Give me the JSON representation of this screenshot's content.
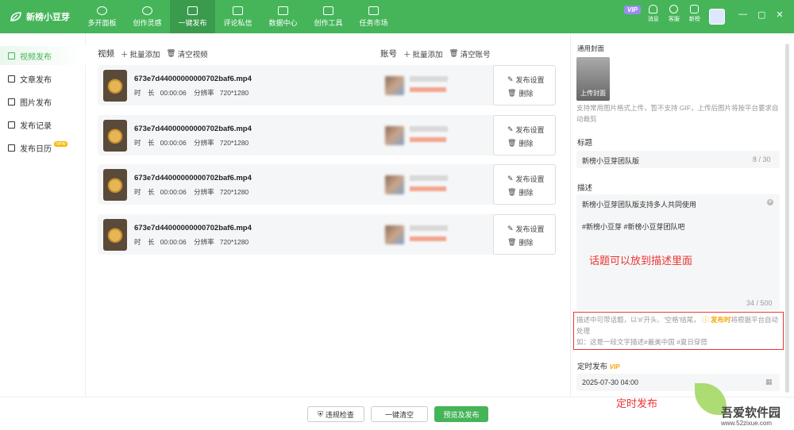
{
  "app": {
    "title": "新榜小豆芽"
  },
  "nav": [
    {
      "label": "多开面板"
    },
    {
      "label": "创作灵感"
    },
    {
      "label": "一键发布"
    },
    {
      "label": "评论私信"
    },
    {
      "label": "数据中心"
    },
    {
      "label": "创作工具"
    },
    {
      "label": "任务市场"
    }
  ],
  "tools": {
    "vip": "VIP",
    "messages": "消息",
    "service": "客服",
    "xinbang": "新榜"
  },
  "window": {
    "minimize": "—",
    "maximize": "▢",
    "close": "✕"
  },
  "sidebar": [
    {
      "label": "视频发布"
    },
    {
      "label": "文章发布"
    },
    {
      "label": "图片发布"
    },
    {
      "label": "发布记录"
    },
    {
      "label": "发布日历",
      "badge": "new"
    }
  ],
  "video_header": {
    "title": "视频",
    "batch_add": "批量添加",
    "clear": "清空视频"
  },
  "account_header": {
    "title": "账号",
    "batch_add": "批量添加",
    "clear": "清空账号"
  },
  "videos": [
    {
      "file": "673e7d44000000000702baf6.mp4",
      "dur_label": "时　长",
      "duration": "00:00:06",
      "res_label": "分辨率",
      "resolution": "720*1280",
      "settings": "发布设置",
      "delete": "删除"
    },
    {
      "file": "673e7d44000000000702baf6.mp4",
      "dur_label": "时　长",
      "duration": "00:00:06",
      "res_label": "分辨率",
      "resolution": "720*1280",
      "settings": "发布设置",
      "delete": "删除"
    },
    {
      "file": "673e7d44000000000702baf6.mp4",
      "dur_label": "时　长",
      "duration": "00:00:06",
      "res_label": "分辨率",
      "resolution": "720*1280",
      "settings": "发布设置",
      "delete": "删除"
    },
    {
      "file": "673e7d44000000000702baf6.mp4",
      "dur_label": "时　长",
      "duration": "00:00:06",
      "res_label": "分辨率",
      "resolution": "720*1280",
      "settings": "发布设置",
      "delete": "删除"
    }
  ],
  "panel": {
    "cover_label": "通用封面",
    "upload_cover": "上传封面",
    "cover_hint": "支持常用图片格式上传，暂不支持 GIF，上传后图片将按平台要求自动裁剪",
    "title_label": "标题",
    "title_value": "新榜小豆芽团队版",
    "title_count": "8 / 30",
    "desc_label": "描述",
    "desc_line1": "新榜小豆芽团队版支持多人共同使用",
    "desc_line2": "#新榜小豆芽 #新榜小豆芽团队吧",
    "desc_count": "34 / 500",
    "annotation_topics": "话题可以放到描述里面",
    "notice_a": "描述中可带话题，以'#'开头、'空格'结尾，",
    "notice_b": "发布时",
    "notice_c": "将根据平台自动处理",
    "notice_d": "如：这是一段文字描述#最美中国 #夏日穿搭",
    "schedule_label": "定时发布",
    "schedule_vip": "VIP",
    "schedule_value": "2025-07-30 04:00",
    "annotation_schedule": "定时发布"
  },
  "bottom": {
    "check": "违规检查",
    "clear": "一键清空",
    "publish": "预览及发布"
  },
  "watermark": {
    "title": "吾爱软件园",
    "url": "www.52zixue.com"
  },
  "colors": {
    "brand": "#46b55a",
    "annotation": "#e33333",
    "vip": "#9b8cf2"
  }
}
